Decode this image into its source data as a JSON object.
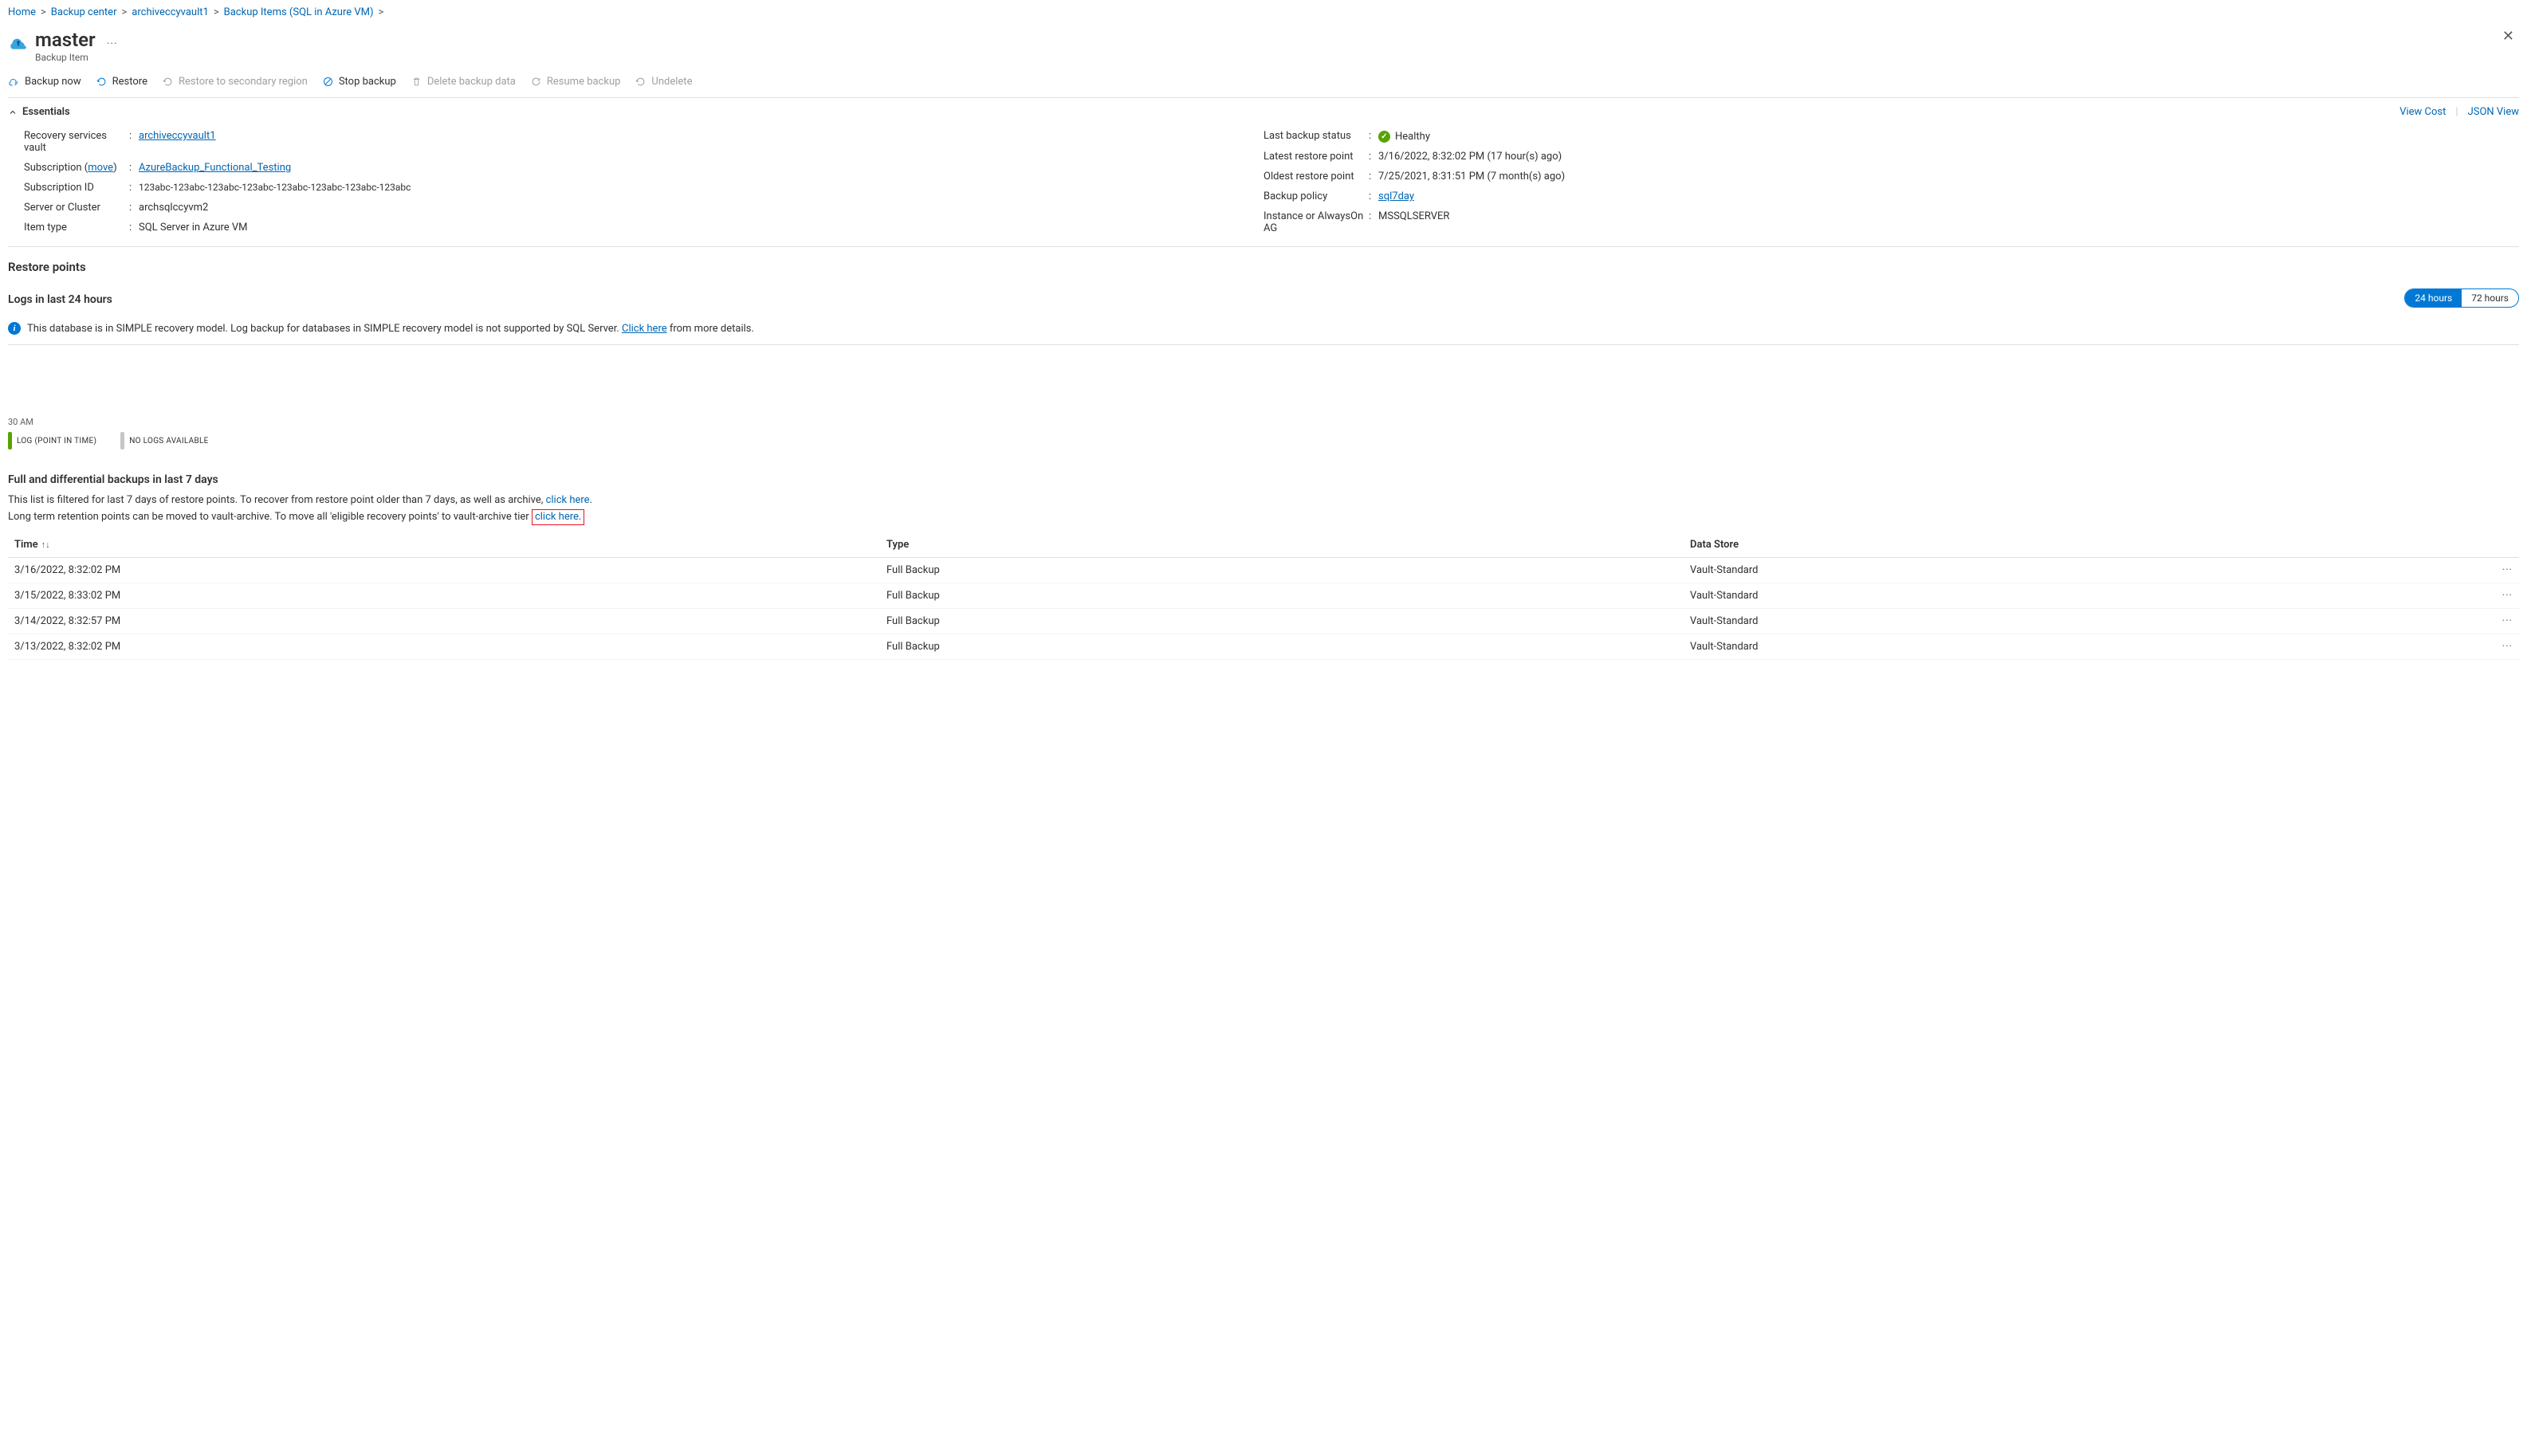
{
  "breadcrumb": {
    "home": "Home",
    "backup_center": "Backup center",
    "vault": "archiveccyvault1",
    "items": "Backup Items (SQL in Azure VM)"
  },
  "header": {
    "title": "master",
    "subtitle": "Backup Item"
  },
  "commands": {
    "backup_now": "Backup now",
    "restore": "Restore",
    "restore_secondary": "Restore to secondary region",
    "stop_backup": "Stop backup",
    "delete_backup": "Delete backup data",
    "resume_backup": "Resume backup",
    "undelete": "Undelete"
  },
  "essentials": {
    "toggle_label": "Essentials",
    "view_cost": "View Cost",
    "json_view": "JSON View",
    "left": {
      "vault_label": "Recovery services vault",
      "vault_value": "archiveccyvault1",
      "subscription_label": "Subscription (",
      "subscription_move": "move",
      "subscription_label_close": ")",
      "subscription_value": "AzureBackup_Functional_Testing",
      "sub_id_label": "Subscription ID",
      "sub_id_value": "123abc-123abc-123abc-123abc-123abc-123abc-123abc-123abc",
      "server_label": "Server or Cluster",
      "server_value": "archsqlccyvm2",
      "item_type_label": "Item type",
      "item_type_value": "SQL Server in Azure VM"
    },
    "right": {
      "last_status_label": "Last backup status",
      "last_status_value": "Healthy",
      "latest_rp_label": "Latest restore point",
      "latest_rp_value": "3/16/2022, 8:32:02 PM (17 hour(s) ago)",
      "oldest_rp_label": "Oldest restore point",
      "oldest_rp_value": "7/25/2021, 8:31:51 PM (7 month(s) ago)",
      "policy_label": "Backup policy",
      "policy_value": "sql7day",
      "instance_label": "Instance or AlwaysOn AG",
      "instance_value": "MSSQLSERVER"
    }
  },
  "restore_points_heading": "Restore points",
  "logs": {
    "heading": "Logs in last 24 hours",
    "pill_24": "24 hours",
    "pill_72": "72 hours",
    "info_text_pre": "This database is in SIMPLE recovery model. Log backup for databases in SIMPLE recovery model is not supported by SQL Server. ",
    "info_link": "Click here",
    "info_text_post": " from more details.",
    "tick_label": "30 AM",
    "legend_log": "LOG (POINT IN TIME)",
    "legend_nologs": "NO LOGS AVAILABLE"
  },
  "full_diff": {
    "heading": "Full and differential backups in last 7 days",
    "desc1_pre": "This list is filtered for last 7 days of restore points. To recover from restore point older than 7 days, as well as archive, ",
    "desc1_link": "click here",
    "desc1_post": ".",
    "desc2_pre": "Long term retention points can be moved to vault-archive. To move all 'eligible recovery points' to vault-archive tier ",
    "desc2_link": "click here",
    "desc2_post": "."
  },
  "table": {
    "col_time": "Time",
    "col_type": "Type",
    "col_ds": "Data Store",
    "rows": [
      {
        "time": "3/16/2022, 8:32:02 PM",
        "type": "Full Backup",
        "ds": "Vault-Standard"
      },
      {
        "time": "3/15/2022, 8:33:02 PM",
        "type": "Full Backup",
        "ds": "Vault-Standard"
      },
      {
        "time": "3/14/2022, 8:32:57 PM",
        "type": "Full Backup",
        "ds": "Vault-Standard"
      },
      {
        "time": "3/13/2022, 8:32:02 PM",
        "type": "Full Backup",
        "ds": "Vault-Standard"
      }
    ]
  }
}
